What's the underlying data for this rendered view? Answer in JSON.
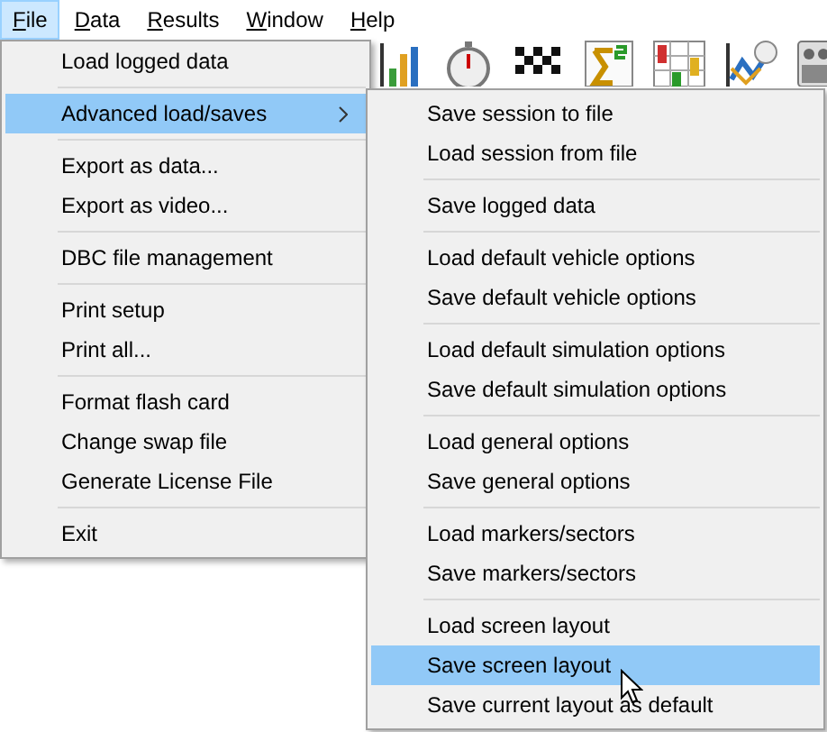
{
  "menubar": [
    {
      "label": "File",
      "selected": true
    },
    {
      "label": "Data",
      "selected": false
    },
    {
      "label": "Results",
      "selected": false
    },
    {
      "label": "Window",
      "selected": false
    },
    {
      "label": "Help",
      "selected": false
    }
  ],
  "file_menu": {
    "groups": [
      [
        {
          "label": "Load logged data",
          "selected": false,
          "submenu": false
        }
      ],
      [
        {
          "label": "Advanced load/saves",
          "selected": true,
          "submenu": true
        }
      ],
      [
        {
          "label": "Export as data...",
          "selected": false,
          "submenu": false
        },
        {
          "label": "Export as video...",
          "selected": false,
          "submenu": false
        }
      ],
      [
        {
          "label": "DBC file management",
          "selected": false,
          "submenu": false
        }
      ],
      [
        {
          "label": "Print setup",
          "selected": false,
          "submenu": false
        },
        {
          "label": "Print all...",
          "selected": false,
          "submenu": false
        }
      ],
      [
        {
          "label": "Format flash card",
          "selected": false,
          "submenu": false
        },
        {
          "label": "Change swap file",
          "selected": false,
          "submenu": false
        },
        {
          "label": "Generate License File",
          "selected": false,
          "submenu": false
        }
      ],
      [
        {
          "label": "Exit",
          "selected": false,
          "submenu": false
        }
      ]
    ]
  },
  "submenu": {
    "groups": [
      [
        {
          "label": "Save session to file",
          "selected": false
        },
        {
          "label": "Load session from file",
          "selected": false
        }
      ],
      [
        {
          "label": "Save logged data",
          "selected": false
        }
      ],
      [
        {
          "label": "Load default vehicle options",
          "selected": false
        },
        {
          "label": "Save default vehicle options",
          "selected": false
        }
      ],
      [
        {
          "label": "Load default simulation options",
          "selected": false
        },
        {
          "label": "Save default simulation options",
          "selected": false
        }
      ],
      [
        {
          "label": "Load general options",
          "selected": false
        },
        {
          "label": "Save general options",
          "selected": false
        }
      ],
      [
        {
          "label": "Load markers/sectors",
          "selected": false
        },
        {
          "label": "Save markers/sectors",
          "selected": false
        }
      ],
      [
        {
          "label": "Load screen layout",
          "selected": false
        },
        {
          "label": "Save screen layout",
          "selected": true
        },
        {
          "label": "Save current layout as default",
          "selected": false
        }
      ]
    ]
  }
}
